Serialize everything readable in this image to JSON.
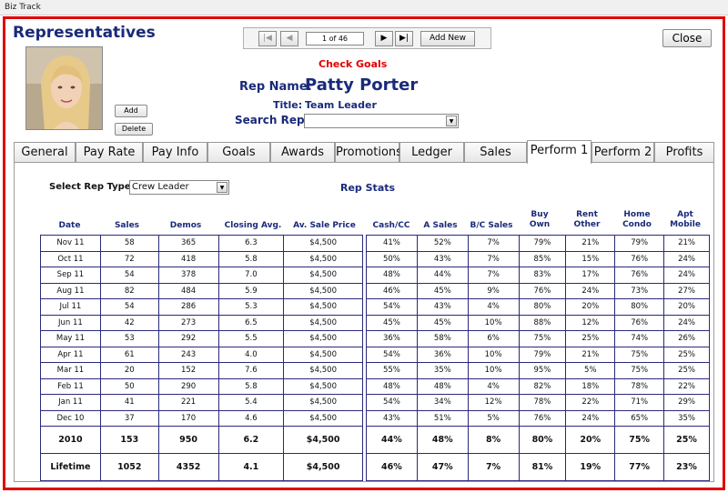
{
  "window": {
    "title": "Biz Track"
  },
  "header": {
    "title": "Representatives",
    "close_label": "Close",
    "add_label": "Add",
    "delete_label": "Delete",
    "check_goals": "Check Goals",
    "rep_name_label": "Rep Name:",
    "rep_name": "Patty Porter",
    "title_label": "Title:",
    "title_value": "Team Leader",
    "search_label": "Search Rep:",
    "search_value": ""
  },
  "nav": {
    "counter": "1 of 46",
    "add_new_label": "Add New"
  },
  "tabs": [
    "General",
    "Pay Rate",
    "Pay Info",
    "Goals",
    "Awards",
    "Promotions",
    "Ledger",
    "Sales",
    "Perform 1",
    "Perform 2",
    "Profits"
  ],
  "active_tab": "Perform 1",
  "panel": {
    "select_label": "Select Rep Type",
    "select_value": "Crew Leader",
    "stats_title": "Rep Stats"
  },
  "left_headers": [
    "Date",
    "Sales",
    "Demos",
    "Closing Avg.",
    "Av. Sale Price"
  ],
  "right_headers": [
    "Cash/CC",
    "A Sales",
    "B/C Sales",
    "Buy Own",
    "Rent Other",
    "Home Condo",
    "Apt Mobile"
  ],
  "rows": [
    {
      "date": "Nov 11",
      "sales": "58",
      "demos": "365",
      "closing": "6.3",
      "price": "$4,500",
      "cash": "41%",
      "a": "52%",
      "bc": "7%",
      "buy": "79%",
      "rent": "21%",
      "home": "79%",
      "apt": "21%"
    },
    {
      "date": "Oct 11",
      "sales": "72",
      "demos": "418",
      "closing": "5.8",
      "price": "$4,500",
      "cash": "50%",
      "a": "43%",
      "bc": "7%",
      "buy": "85%",
      "rent": "15%",
      "home": "76%",
      "apt": "24%"
    },
    {
      "date": "Sep 11",
      "sales": "54",
      "demos": "378",
      "closing": "7.0",
      "price": "$4,500",
      "cash": "48%",
      "a": "44%",
      "bc": "7%",
      "buy": "83%",
      "rent": "17%",
      "home": "76%",
      "apt": "24%"
    },
    {
      "date": "Aug 11",
      "sales": "82",
      "demos": "484",
      "closing": "5.9",
      "price": "$4,500",
      "cash": "46%",
      "a": "45%",
      "bc": "9%",
      "buy": "76%",
      "rent": "24%",
      "home": "73%",
      "apt": "27%"
    },
    {
      "date": "Jul 11",
      "sales": "54",
      "demos": "286",
      "closing": "5.3",
      "price": "$4,500",
      "cash": "54%",
      "a": "43%",
      "bc": "4%",
      "buy": "80%",
      "rent": "20%",
      "home": "80%",
      "apt": "20%"
    },
    {
      "date": "Jun 11",
      "sales": "42",
      "demos": "273",
      "closing": "6.5",
      "price": "$4,500",
      "cash": "45%",
      "a": "45%",
      "bc": "10%",
      "buy": "88%",
      "rent": "12%",
      "home": "76%",
      "apt": "24%"
    },
    {
      "date": "May 11",
      "sales": "53",
      "demos": "292",
      "closing": "5.5",
      "price": "$4,500",
      "cash": "36%",
      "a": "58%",
      "bc": "6%",
      "buy": "75%",
      "rent": "25%",
      "home": "74%",
      "apt": "26%"
    },
    {
      "date": "Apr 11",
      "sales": "61",
      "demos": "243",
      "closing": "4.0",
      "price": "$4,500",
      "cash": "54%",
      "a": "36%",
      "bc": "10%",
      "buy": "79%",
      "rent": "21%",
      "home": "75%",
      "apt": "25%"
    },
    {
      "date": "Mar 11",
      "sales": "20",
      "demos": "152",
      "closing": "7.6",
      "price": "$4,500",
      "cash": "55%",
      "a": "35%",
      "bc": "10%",
      "buy": "95%",
      "rent": "5%",
      "home": "75%",
      "apt": "25%"
    },
    {
      "date": "Feb 11",
      "sales": "50",
      "demos": "290",
      "closing": "5.8",
      "price": "$4,500",
      "cash": "48%",
      "a": "48%",
      "bc": "4%",
      "buy": "82%",
      "rent": "18%",
      "home": "78%",
      "apt": "22%"
    },
    {
      "date": "Jan 11",
      "sales": "41",
      "demos": "221",
      "closing": "5.4",
      "price": "$4,500",
      "cash": "54%",
      "a": "34%",
      "bc": "12%",
      "buy": "78%",
      "rent": "22%",
      "home": "71%",
      "apt": "29%"
    },
    {
      "date": "Dec 10",
      "sales": "37",
      "demos": "170",
      "closing": "4.6",
      "price": "$4,500",
      "cash": "43%",
      "a": "51%",
      "bc": "5%",
      "buy": "76%",
      "rent": "24%",
      "home": "65%",
      "apt": "35%"
    }
  ],
  "totals": [
    {
      "date": "2010",
      "sales": "153",
      "demos": "950",
      "closing": "6.2",
      "price": "$4,500",
      "cash": "44%",
      "a": "48%",
      "bc": "8%",
      "buy": "80%",
      "rent": "20%",
      "home": "75%",
      "apt": "25%"
    },
    {
      "date": "Lifetime",
      "sales": "1052",
      "demos": "4352",
      "closing": "4.1",
      "price": "$4,500",
      "cash": "46%",
      "a": "47%",
      "bc": "7%",
      "buy": "81%",
      "rent": "19%",
      "home": "77%",
      "apt": "23%"
    }
  ],
  "colors": {
    "frame": "#e00000",
    "heading": "#1a2a7a",
    "check_goals": "#e00000",
    "grid_border": "#2a2a7a"
  }
}
